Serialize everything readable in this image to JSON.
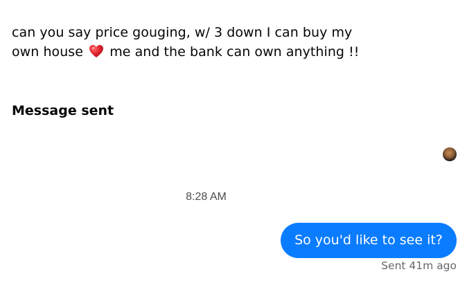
{
  "incoming_message": {
    "line_before_heart": "can you say price gouging, w/ 3 down I can buy my own house",
    "heart_icon": "red-heart-emoji",
    "line_after_heart": "me and the bank can own anything !!",
    "status_heading": "Message sent"
  },
  "avatar": {
    "icon": "contact-avatar"
  },
  "divider": {
    "timestamp": "8:28 AM"
  },
  "outgoing_message": {
    "text": "So you'd like to see it?",
    "bubble_color": "#0a7cff",
    "status": "Sent 41m ago"
  },
  "colors": {
    "background": "#ffffff",
    "text": "#050505",
    "muted": "#65676b",
    "heart": "#e0242f"
  }
}
